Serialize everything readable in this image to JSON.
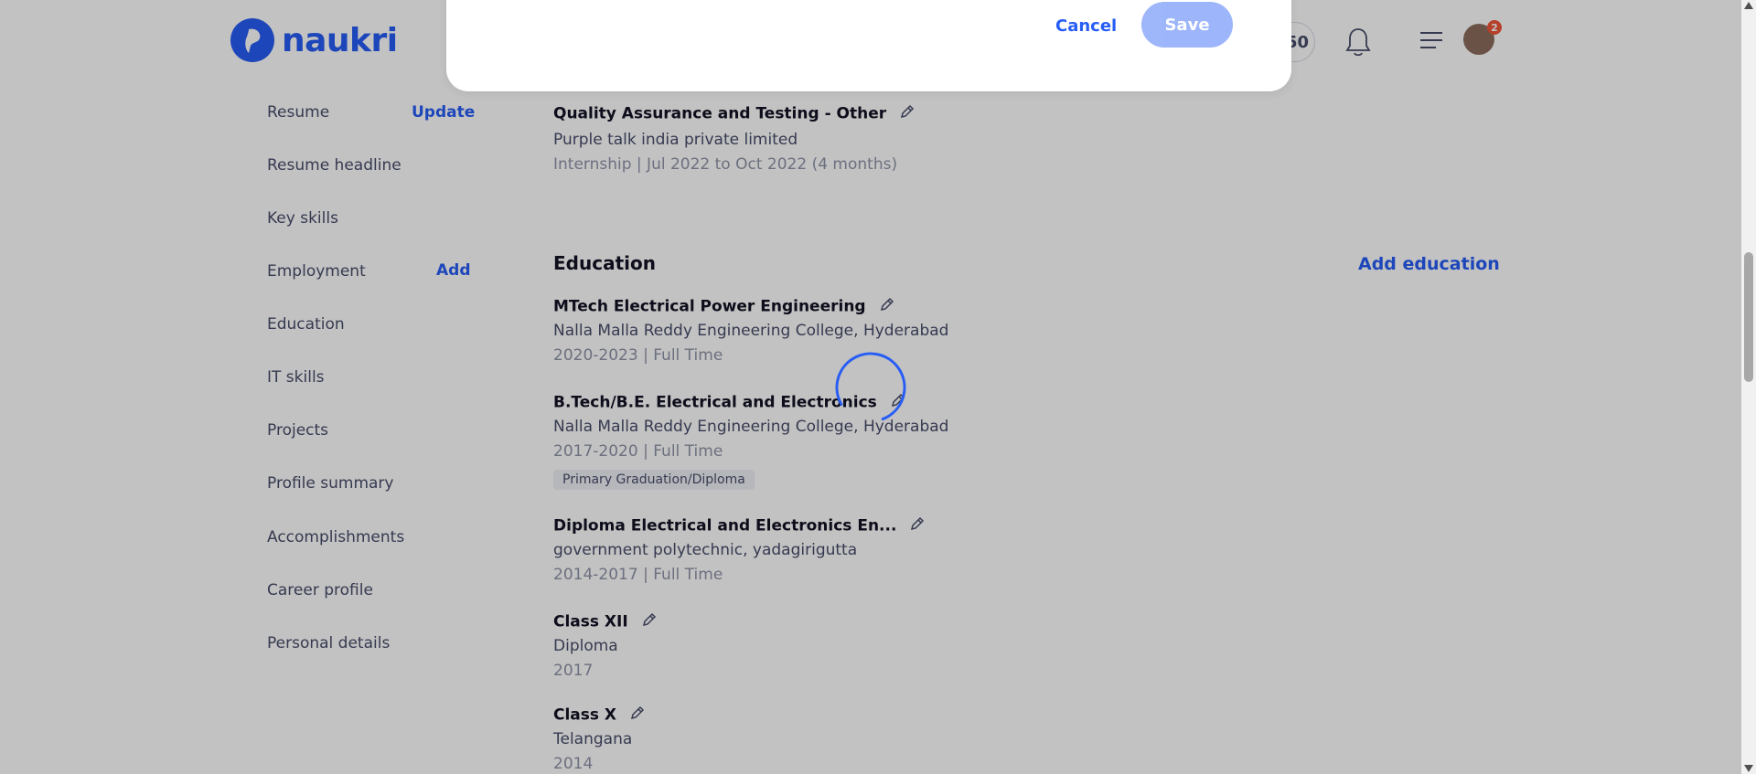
{
  "header": {
    "logo_text": "naukri",
    "score": "50",
    "notification_count": "2",
    "icons": {
      "bell": "bell-icon",
      "menu": "menu-icon",
      "avatar": "user-avatar"
    }
  },
  "sidebar": {
    "items": [
      {
        "label": "Resume",
        "action": "Update"
      },
      {
        "label": "Resume headline"
      },
      {
        "label": "Key skills"
      },
      {
        "label": "Employment",
        "action": "Add"
      },
      {
        "label": "Education"
      },
      {
        "label": "IT skills"
      },
      {
        "label": "Projects"
      },
      {
        "label": "Profile summary"
      },
      {
        "label": "Accomplishments"
      },
      {
        "label": "Career profile"
      },
      {
        "label": "Personal details"
      }
    ]
  },
  "employment": {
    "title": "Quality Assurance and Testing - Other",
    "company": "Purple talk india private limited",
    "duration": "Internship | Jul 2022 to Oct 2022 (4 months)"
  },
  "education": {
    "title": "Education",
    "add_label": "Add education",
    "entries": [
      {
        "degree": "MTech Electrical Power Engineering",
        "institute": "Nalla Malla Reddy Engineering College, Hyderabad",
        "meta": "2020-2023 | Full Time"
      },
      {
        "degree": "B.Tech/B.E. Electrical and Electronics",
        "institute": "Nalla Malla Reddy Engineering College, Hyderabad",
        "meta": "2017-2020 | Full Time",
        "tag": "Primary Graduation/Diploma"
      },
      {
        "degree": "Diploma Electrical and Electronics En...",
        "institute": "government polytechnic, yadagirigutta",
        "meta": "2014-2017 | Full Time"
      },
      {
        "degree": "Class XII",
        "institute": "Diploma",
        "meta": "2017"
      },
      {
        "degree": "Class X",
        "institute": "Telangana",
        "meta": "2014"
      }
    ]
  },
  "modal": {
    "cancel_label": "Cancel",
    "save_label": "Save"
  },
  "colors": {
    "accent": "#275df5",
    "overlay": "rgba(0,0,0,0.24)",
    "text_primary": "#121224",
    "text_secondary": "#474d6a",
    "text_muted": "#8f94a8"
  }
}
